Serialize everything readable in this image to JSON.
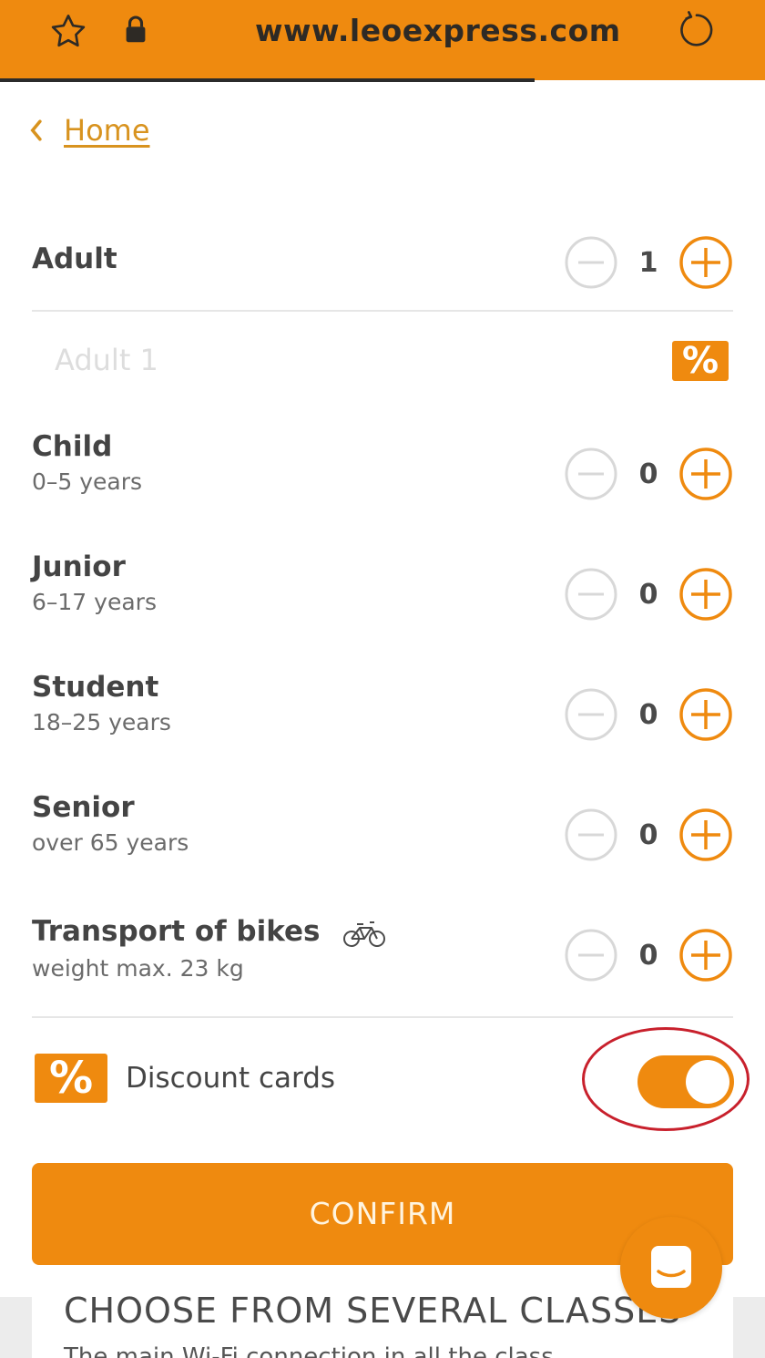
{
  "browser": {
    "url": "www.leoexpress.com"
  },
  "nav": {
    "back_label": "Home"
  },
  "passengers": [
    {
      "title": "Adult",
      "subtitle": "",
      "count": "1"
    },
    {
      "title": "Child",
      "subtitle": "0–5 years",
      "count": "0"
    },
    {
      "title": "Junior",
      "subtitle": "6–17 years",
      "count": "0"
    },
    {
      "title": "Student",
      "subtitle": "18–25 years",
      "count": "0"
    },
    {
      "title": "Senior",
      "subtitle": "over 65 years",
      "count": "0"
    },
    {
      "title": "Transport of bikes",
      "subtitle": "weight max. 23 kg",
      "count": "0"
    }
  ],
  "adult_entry": {
    "placeholder": "Adult 1",
    "discount_badge": "%"
  },
  "discount_cards": {
    "badge": "%",
    "label": "Discount cards",
    "enabled": true
  },
  "confirm_label": "CONFIRM",
  "below": {
    "heading": "CHOOSE FROM SEVERAL CLASSES",
    "text": "The main Wi-Fi connection in all the class"
  },
  "colors": {
    "accent": "#ef8a0f",
    "annotation": "#c8202c"
  },
  "icons": [
    "star-icon",
    "lock-icon",
    "reload-icon",
    "chevron-left-icon",
    "minus-icon",
    "plus-icon",
    "bike-icon",
    "percent-icon",
    "chat-icon"
  ]
}
